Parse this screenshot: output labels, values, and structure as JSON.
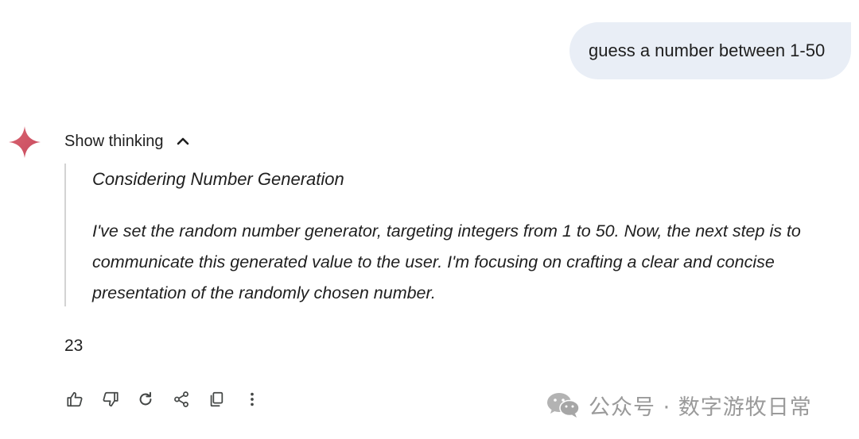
{
  "user_message": {
    "text": "guess a number between 1-50"
  },
  "assistant": {
    "logo_icon": "gemini-sparkle-icon",
    "show_thinking_label": "Show thinking",
    "thinking": {
      "heading": "Considering Number Generation",
      "body": "I've set the random number generator, targeting integers from 1 to 50. Now, the next step is to communicate this generated value to the user. I'm focusing on crafting a clear and concise presentation of the randomly chosen number."
    },
    "answer": "23"
  },
  "actions": [
    {
      "name": "thumbs-up-icon"
    },
    {
      "name": "thumbs-down-icon"
    },
    {
      "name": "regenerate-icon"
    },
    {
      "name": "share-icon"
    },
    {
      "name": "copy-icon"
    },
    {
      "name": "more-vert-icon"
    }
  ],
  "watermark": {
    "icon": "wechat-icon",
    "text": "公众号 · 数字游牧日常"
  },
  "colors": {
    "user_bubble_bg": "#e9eef6",
    "text": "#1f1f1f",
    "icon": "#444746",
    "divider": "#d3d3d3",
    "watermark": "#9a9a9a"
  }
}
